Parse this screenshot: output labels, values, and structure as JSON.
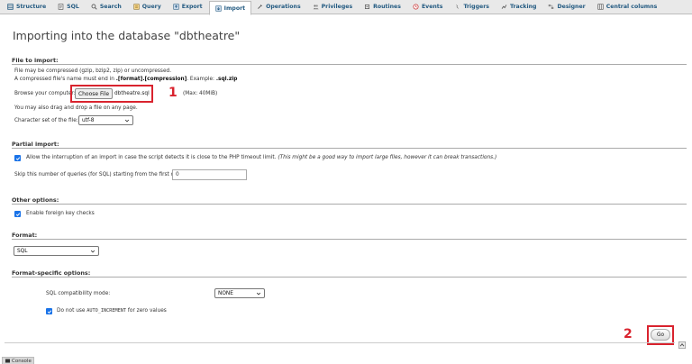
{
  "tabs": [
    {
      "label": "Structure",
      "icon": "structure-icon"
    },
    {
      "label": "SQL",
      "icon": "sql-icon"
    },
    {
      "label": "Search",
      "icon": "search-icon"
    },
    {
      "label": "Query",
      "icon": "query-icon"
    },
    {
      "label": "Export",
      "icon": "export-icon"
    },
    {
      "label": "Import",
      "icon": "import-icon",
      "active": true
    },
    {
      "label": "Operations",
      "icon": "operations-icon"
    },
    {
      "label": "Privileges",
      "icon": "privileges-icon"
    },
    {
      "label": "Routines",
      "icon": "routines-icon"
    },
    {
      "label": "Events",
      "icon": "events-icon"
    },
    {
      "label": "Triggers",
      "icon": "triggers-icon"
    },
    {
      "label": "Tracking",
      "icon": "tracking-icon"
    },
    {
      "label": "Designer",
      "icon": "designer-icon"
    },
    {
      "label": "Central columns",
      "icon": "central-columns-icon"
    }
  ],
  "page_title": "Importing into the database \"dbtheatre\"",
  "file_to_import": {
    "heading": "File to import:",
    "line1": "File may be compressed (gzip, bzip2, zip) or uncompressed.",
    "line2_prefix": "A compressed file's name must end in ",
    "line2_bold": ".[format].[compression]",
    "line2_mid": ". Example: ",
    "line2_example": ".sql.zip",
    "browse_label": "Browse your computer:",
    "choose_file_label": "Choose File",
    "file_name": "dbtheatre.sql",
    "max_size": "(Max: 40MiB)",
    "drag_drop": "You may also drag and drop a file on any page.",
    "charset_label": "Character set of the file:",
    "charset_value": "utf-8",
    "annotation_1": "1"
  },
  "partial_import": {
    "heading": "Partial import:",
    "allow_interrupt_label": "Allow the interruption of an import in case the script detects it is close to the PHP timeout limit.",
    "allow_interrupt_note": "(This might be a good way to import large files, however it can break transactions.)",
    "skip_label": "Skip this number of queries (for SQL) starting from the first one:",
    "skip_value": "0"
  },
  "other_options": {
    "heading": "Other options:",
    "foreign_key_label": "Enable foreign key checks"
  },
  "format": {
    "heading": "Format:",
    "value": "SQL"
  },
  "format_specific": {
    "heading": "Format-specific options:",
    "compat_label": "SQL compatibility mode:",
    "compat_value": "NONE",
    "auto_inc_prefix": "Do not use ",
    "auto_inc_code": "AUTO_INCREMENT",
    "auto_inc_suffix": " for zero values"
  },
  "go_label": "Go",
  "annotation_2": "2",
  "console_label": "Console",
  "colors": {
    "accent": "#235a81",
    "highlight_red": "#d9232e",
    "checkbox_blue": "#1a73e8"
  }
}
